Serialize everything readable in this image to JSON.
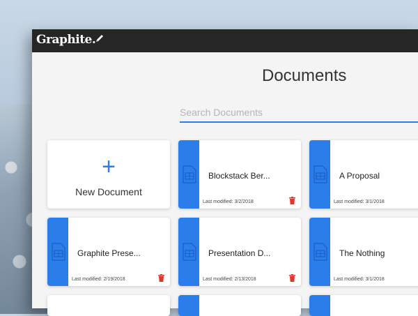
{
  "app": {
    "logo": "Graphite."
  },
  "page": {
    "title": "Documents",
    "search_placeholder": "Search Documents"
  },
  "new_document": {
    "plus": "+",
    "label": "New Document"
  },
  "documents": [
    {
      "title": "Blockstack Ber...",
      "modified": "Last modified: 3/2/2018"
    },
    {
      "title": "A Proposal",
      "modified": "Last modified: 3/1/2018"
    },
    {
      "title": "Graphite Prese...",
      "modified": "Last modified: 2/19/2018"
    },
    {
      "title": "Presentation D...",
      "modified": "Last modified: 2/13/2018"
    },
    {
      "title": "The Nothing",
      "modified": "Last modified: 3/1/2018"
    }
  ],
  "colors": {
    "accent": "#2b7de9",
    "topbar": "#262626",
    "trash": "#e0362c"
  }
}
